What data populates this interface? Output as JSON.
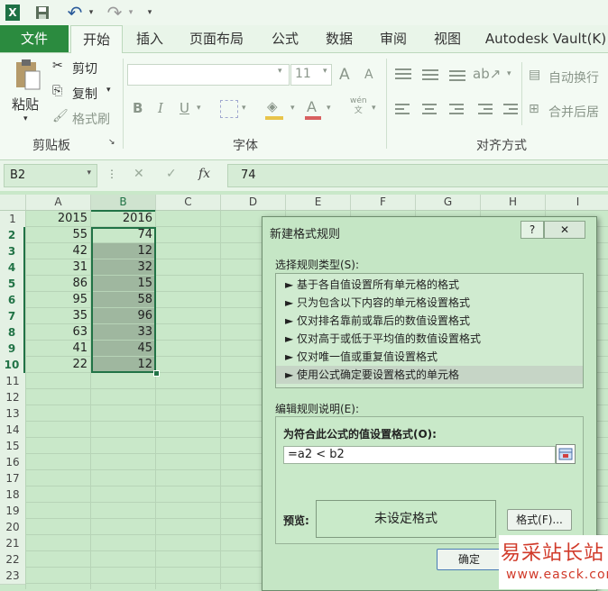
{
  "qat": {
    "excel_icon": "X",
    "undo_icon": "↶",
    "redo_icon": "↷",
    "more_icon": "▾"
  },
  "tabs": [
    "文件",
    "开始",
    "插入",
    "页面布局",
    "公式",
    "数据",
    "审阅",
    "视图",
    "Autodesk Vault(K)"
  ],
  "ribbon": {
    "paste": "粘贴",
    "cut": "剪切",
    "copy": "复制",
    "format_painter": "格式刷",
    "clipboard_group": "剪贴板",
    "font_size": "11",
    "font_group": "字体",
    "wrap_text": "自动换行",
    "merge_center": "合并后居",
    "align_group": "对齐方式",
    "bold": "B",
    "italic": "I",
    "underline": "U",
    "grow_font": "A",
    "shrink_font": "A",
    "font_color": "A",
    "phonetic": "wén\n文"
  },
  "formula_bar": {
    "name_box": "B2",
    "fx": "fx",
    "value": "74"
  },
  "columns": [
    "A",
    "B",
    "C",
    "D",
    "E",
    "F",
    "G",
    "H",
    "I"
  ],
  "rows": [
    "1",
    "2",
    "3",
    "4",
    "5",
    "6",
    "7",
    "8",
    "9",
    "10",
    "11",
    "12",
    "13",
    "14",
    "15",
    "16",
    "17",
    "18",
    "19",
    "20",
    "21",
    "22",
    "23"
  ],
  "colA": [
    "2015",
    "55",
    "42",
    "31",
    "86",
    "95",
    "35",
    "63",
    "41",
    "22"
  ],
  "colB": [
    "2016",
    "74",
    "12",
    "32",
    "15",
    "58",
    "96",
    "33",
    "45",
    "12"
  ],
  "dialog": {
    "title": "新建格式规则",
    "help": "?",
    "close": "✕",
    "select_type_label": "选择规则类型(S):",
    "rule_types": [
      "► 基于各自值设置所有单元格的格式",
      "► 只为包含以下内容的单元格设置格式",
      "► 仅对排名靠前或靠后的数值设置格式",
      "► 仅对高于或低于平均值的数值设置格式",
      "► 仅对唯一值或重复值设置格式",
      "► 使用公式确定要设置格式的单元格"
    ],
    "edit_desc_label": "编辑规则说明(E):",
    "formula_label": "为符合此公式的值设置格式(O):",
    "formula_value": "=a2 < b2",
    "preview_label": "预览:",
    "preview_text": "未设定格式",
    "format_button": "格式(F)...",
    "ok_button": "确定"
  },
  "watermark": {
    "text": "易采站长站",
    "url": "www.easck.com"
  }
}
